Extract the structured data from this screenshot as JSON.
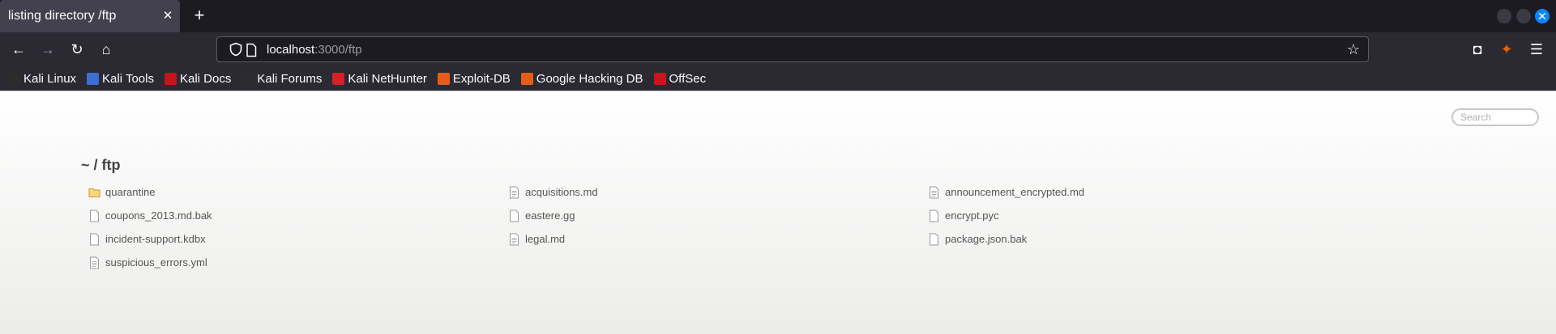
{
  "tab": {
    "title": "listing directory /ftp",
    "close_glyph": "✕",
    "new_tab_glyph": "+"
  },
  "window_controls": {
    "close_glyph": "✕"
  },
  "nav": {
    "back_glyph": "←",
    "forward_glyph": "→",
    "reload_glyph": "↻",
    "home_glyph": "⌂",
    "url_host": "localhost",
    "url_rest": ":3000/ftp",
    "star_glyph": "☆",
    "pocket_glyph": "◘",
    "extension_glyph": "✦",
    "menu_glyph": "☰"
  },
  "bookmarks": [
    {
      "label": "Kali Linux",
      "icon": "kali-dragon-icon",
      "color": "#2c2c2c"
    },
    {
      "label": "Kali Tools",
      "icon": "kali-tools-icon",
      "color": "#3b6fd6"
    },
    {
      "label": "Kali Docs",
      "icon": "kali-docs-icon",
      "color": "#c4161c"
    },
    {
      "label": "Kali Forums",
      "icon": "kali-forums-icon",
      "color": "#2c2c2c"
    },
    {
      "label": "Kali NetHunter",
      "icon": "nethunter-icon",
      "color": "#d4202a"
    },
    {
      "label": "Exploit-DB",
      "icon": "exploit-db-icon",
      "color": "#e65d1a"
    },
    {
      "label": "Google Hacking DB",
      "icon": "ghdb-icon",
      "color": "#e65d1a"
    },
    {
      "label": "OffSec",
      "icon": "offsec-icon",
      "color": "#c4161c"
    }
  ],
  "page": {
    "search_placeholder": "Search",
    "heading": "~ / ftp",
    "files": [
      {
        "name": "quarantine",
        "type": "folder"
      },
      {
        "name": "acquisitions.md",
        "type": "text"
      },
      {
        "name": "announcement_encrypted.md",
        "type": "text"
      },
      {
        "name": "coupons_2013.md.bak",
        "type": "file"
      },
      {
        "name": "eastere.gg",
        "type": "file"
      },
      {
        "name": "encrypt.pyc",
        "type": "file"
      },
      {
        "name": "incident-support.kdbx",
        "type": "file"
      },
      {
        "name": "legal.md",
        "type": "text"
      },
      {
        "name": "package.json.bak",
        "type": "file"
      },
      {
        "name": "suspicious_errors.yml",
        "type": "text"
      }
    ]
  }
}
